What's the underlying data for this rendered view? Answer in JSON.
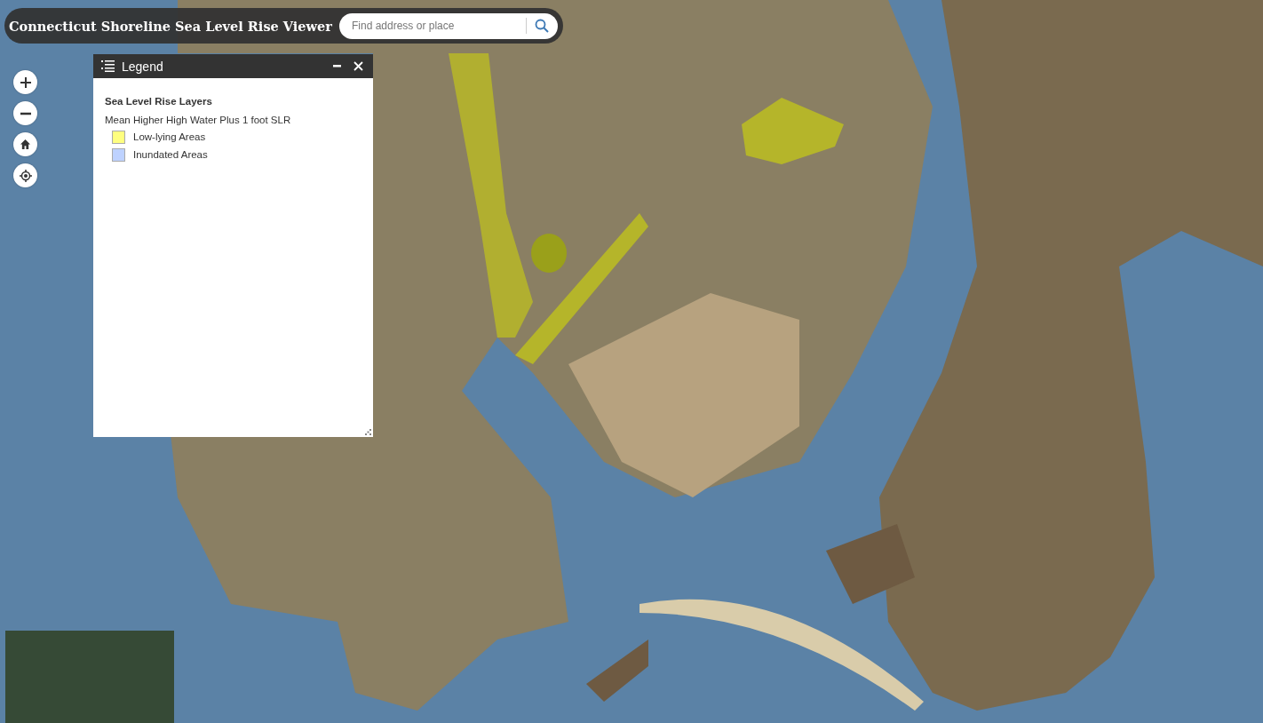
{
  "app": {
    "title": "Connecticut Shoreline Sea Level Rise Viewer"
  },
  "search": {
    "placeholder": "Find address or place"
  },
  "legend": {
    "title": "Legend",
    "heading": "Sea Level Rise Layers",
    "layer": "Mean Higher High Water Plus 1 foot SLR",
    "items": [
      {
        "label": "Low-lying Areas",
        "color": "#ffff80"
      },
      {
        "label": "Inundated Areas",
        "color": "#bed2ff"
      }
    ]
  }
}
